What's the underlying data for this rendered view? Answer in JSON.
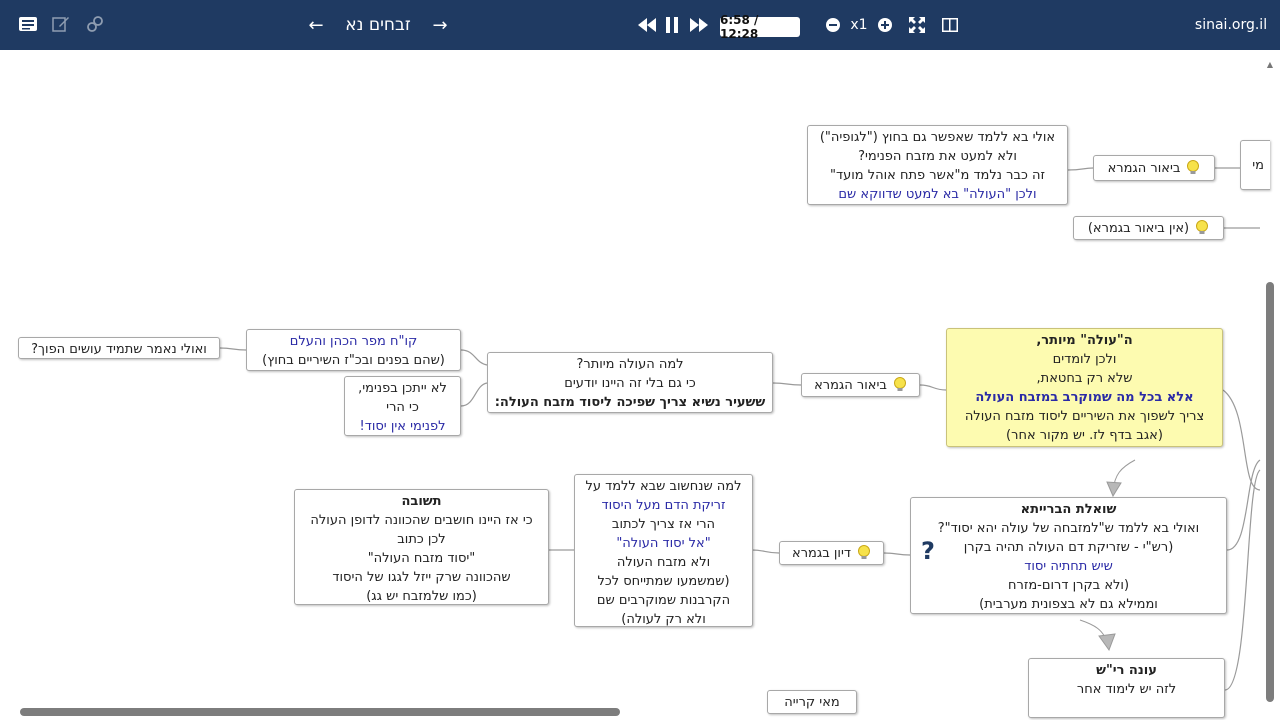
{
  "toolbar": {
    "title": "זבחים נא",
    "time": "6:58 / 12:28",
    "speed": "x1",
    "site": "sinai.org.il"
  },
  "nodes": {
    "n1": [
      "אולי בא ללמד שאפשר גם בחוץ (\"לגופיה\")",
      "ולא למעט את מזבח הפנימי?",
      "זה כבר נלמד מ\"אשר פתח אוהל מועד\"",
      "ולכן \"העולה\" בא למעט שדווקא שם"
    ],
    "biur_top": "ביאור הגמרא",
    "partial_right": "מי",
    "ein_biur": "(אין ביאור בגמרא)",
    "oulai": "ואולי נאמר שתמיד עושים הפוך?",
    "kal": [
      "קו\"ח מפר הכהן והעלם",
      "(שהם בפנים ובכ\"ז השיריים בחוץ)"
    ],
    "lo_yitachen": [
      "לא ייתכן בפנימי,",
      "כי הרי",
      "לפנימי אין יסוד!"
    ],
    "lama": [
      "למה העולה מיותר?",
      "כי גם בלי זה היינו יודעים",
      "ששעיר נשיא צריך שפיכה ליסוד מזבח העולה:"
    ],
    "biur_mid": "ביאור הגמרא",
    "yellow": [
      "ה\"עולה\" מיותר,",
      "ולכן לומדים",
      "שלא רק בחטאת,",
      "אלא בכל מה שמוקרב במזבח העולה",
      "צריך לשפוך את השיריים ליסוד מזבח העולה",
      "(אגב בדף לז. יש מקור אחר)"
    ],
    "teshuva": [
      "תשובה",
      "כי אז היינו חושבים שהכוונה לדופן העולה",
      "לכן כתוב",
      "\"יסוד מזבח העולה\"",
      "שהכוונה שרק ייזל לגגו של היסוד",
      "(כמו שלמזבח יש גג)"
    ],
    "lama2": [
      "למה שנחשוב שבא ללמד על",
      "זריקת הדם מעל היסוד",
      "הרי אז צריך לכתוב",
      "\"אל יסוד העולה\"",
      "ולא מזבח העולה",
      "(שמשמעו שמתייחס לכל",
      "הקרבנות שמוקרבים שם",
      "ולא רק לעולה)"
    ],
    "diyun": "דיון בגמרא",
    "shoelet": [
      "שואלת הברייתא",
      "ואולי בא ללמד ש\"למזבחה של עולה יהא יסוד\"?",
      "(רש\"י - שזריקת דם העולה תהיה בקרן",
      "שיש תחתיה יסוד",
      "(ולא בקרן דרום-מזרח",
      "וממילא גם לא בצפונית מערבית)"
    ],
    "one": [
      "עונה רי\"ש",
      "לזה יש לימוד אחר"
    ],
    "partial_bottom": "מאי קרייה"
  },
  "colors": {
    "topbar": "#1f3a62",
    "link": "#2a2aa6",
    "yellow_node": "#fdfbb0"
  }
}
